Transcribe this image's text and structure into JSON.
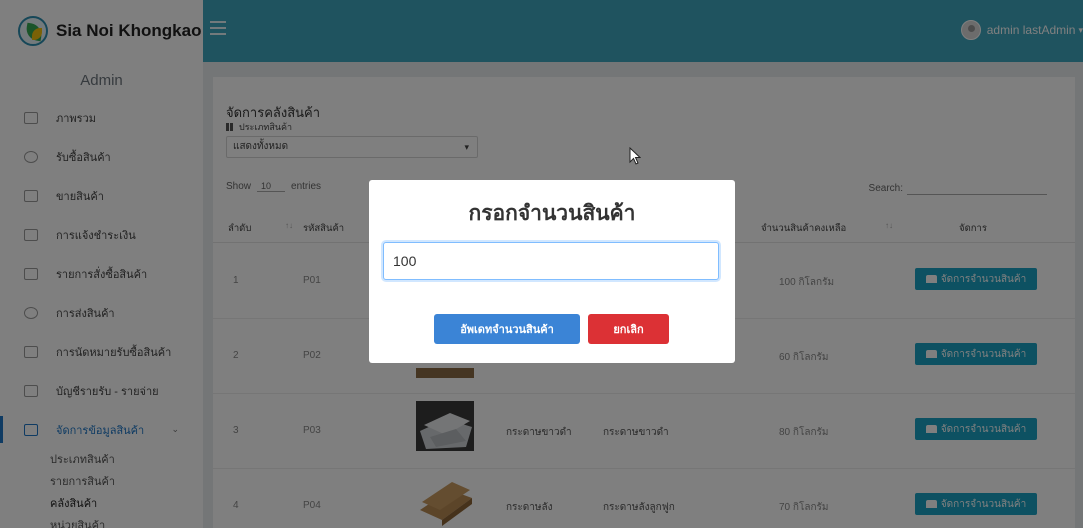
{
  "brand": {
    "name": "Sia Noi Khongkao"
  },
  "user": {
    "name": "admin lastAdmin"
  },
  "sidebar": {
    "title": "Admin",
    "items": [
      {
        "label": "ภาพรวม",
        "icon": "dashboard-icon"
      },
      {
        "label": "รับซื้อสินค้า",
        "icon": "box-icon"
      },
      {
        "label": "ขายสินค้า",
        "icon": "cart-icon"
      },
      {
        "label": "การแจ้งชำระเงิน",
        "icon": "payment-icon"
      },
      {
        "label": "รายการสั่งซื้อสินค้า",
        "icon": "list-icon"
      },
      {
        "label": "การส่งสินค้า",
        "icon": "truck-icon"
      },
      {
        "label": "การนัดหมายรับซื้อสินค้า",
        "icon": "calendar-icon"
      },
      {
        "label": "บัญชีรายรับ - รายจ่าย",
        "icon": "ledger-icon"
      },
      {
        "label": "จัดการข้อมูลสินค้า",
        "icon": "tag-icon",
        "active": true
      }
    ],
    "subitems": [
      "ประเภทสินค้า",
      "รายการสินค้า",
      "คลังสินค้า",
      "หน่วยสินค้า"
    ]
  },
  "page": {
    "heading": "จัดการคลังสินค้า",
    "category_label": "ประเภทสินค้า",
    "category_selected": "แสดงทั้งหมด",
    "show_label": "Show",
    "entries_value": "10",
    "entries_label": "entries",
    "search_label": "Search:"
  },
  "table": {
    "headers": {
      "order": "ลำดับ",
      "code": "รหัสสินค้า",
      "stock": "จำนวนสินค้าคงเหลือ",
      "manage": "จัดการ"
    },
    "manage_button_label": "จัดการจำนวนสินค้า",
    "rows": [
      {
        "order": "1",
        "code": "P01",
        "category": "",
        "name": "",
        "stock": "100 กิโลกรัม"
      },
      {
        "order": "2",
        "code": "P02",
        "category": "",
        "name": "",
        "stock": "60 กิโลกรัม"
      },
      {
        "order": "3",
        "code": "P03",
        "category": "กระดาษขาวดำ",
        "name": "กระดาษขาวดำ",
        "stock": "80 กิโลกรัม"
      },
      {
        "order": "4",
        "code": "P04",
        "category": "กระดาษลัง",
        "name": "กระดาษลังลูกฟูก",
        "stock": "70 กิโลกรัม"
      }
    ]
  },
  "modal": {
    "title": "กรอกจำนวนสินค้า",
    "input_value": "100",
    "update_label": "อัพเดทจำนวนสินค้า",
    "cancel_label": "ยกเลิก"
  },
  "colors": {
    "topbar": "#3fa7bf",
    "primary": "#3b84d6",
    "danger": "#dc3135",
    "info": "#1aa3c4"
  }
}
